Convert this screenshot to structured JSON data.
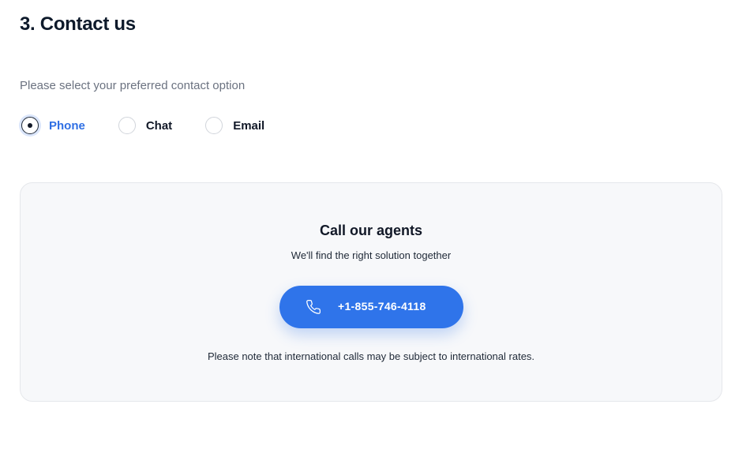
{
  "page": {
    "title": "3. Contact us",
    "subtitle": "Please select your preferred contact option"
  },
  "contact_options": {
    "selected": "Phone",
    "items": [
      {
        "label": "Phone",
        "checked": true
      },
      {
        "label": "Chat",
        "checked": false
      },
      {
        "label": "Email",
        "checked": false
      }
    ]
  },
  "card": {
    "title": "Call our agents",
    "subtitle": "We'll find the right solution together",
    "button": {
      "icon": "phone-icon",
      "phone_number": "+1-855-746-4118"
    },
    "note": "Please note that international calls may be subject to international rates."
  },
  "colors": {
    "accent": "#2f74ea",
    "selected_text": "#2f6fe4",
    "card_background": "#f7f8fa",
    "text_primary": "#111827",
    "text_muted": "#6b7280"
  }
}
